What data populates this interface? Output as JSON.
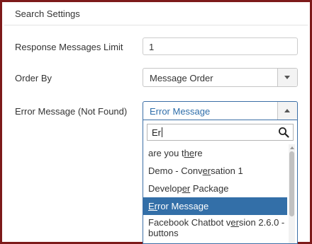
{
  "section": {
    "title": "Search Settings"
  },
  "fields": {
    "response_limit": {
      "label": "Response Messages Limit",
      "value": "1"
    },
    "order_by": {
      "label": "Order By",
      "selected": "Message Order",
      "icon": "chevron-down-icon"
    },
    "error_message": {
      "label": "Error Message (Not Found)",
      "selected": "Error Message",
      "icon": "chevron-up-icon"
    }
  },
  "dropdown": {
    "search_value": "Er",
    "search_icon": "search-icon",
    "options": [
      {
        "pre": "are you t",
        "match": "he",
        "post": "re",
        "selected": false
      },
      {
        "pre": "Demo - Conv",
        "match": "er",
        "post": "sation 1",
        "selected": false
      },
      {
        "pre": "Develop",
        "match": "er",
        "post": " Package",
        "selected": false
      },
      {
        "pre": "",
        "match": "Er",
        "post": "ror Message",
        "selected": true
      },
      {
        "pre": "Facebook Chatbot v",
        "match": "er",
        "post": "sion 2.6.0 - buttons",
        "selected": false
      }
    ]
  },
  "colors": {
    "frame": "#7d1a1a",
    "selected_bg": "#336fa8",
    "open_border": "#3b6ea5"
  }
}
